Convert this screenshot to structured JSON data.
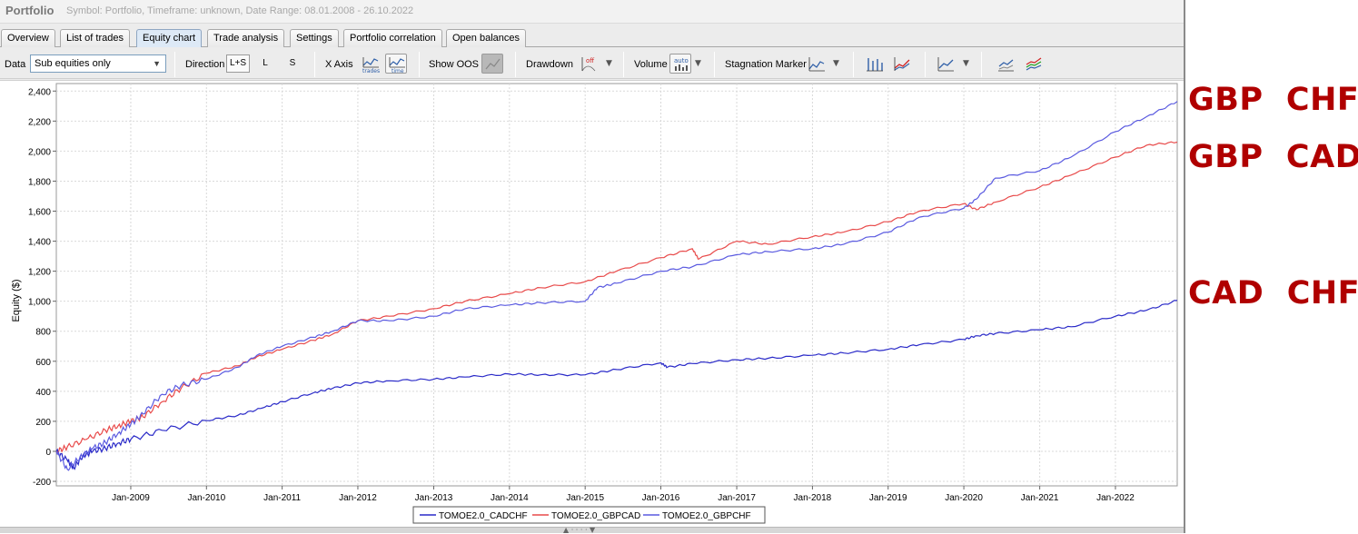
{
  "window": {
    "title": "Portfolio",
    "subtitle": "Symbol: Portfolio, Timeframe: unknown, Date Range: 08.01.2008 - 26.10.2022"
  },
  "tabs": [
    {
      "label": "Overview",
      "active": false
    },
    {
      "label": "List of trades",
      "active": false
    },
    {
      "label": "Equity chart",
      "active": true
    },
    {
      "label": "Trade analysis",
      "active": false
    },
    {
      "label": "Settings",
      "active": false
    },
    {
      "label": "Portfolio correlation",
      "active": false
    },
    {
      "label": "Open balances",
      "active": false
    }
  ],
  "toolbar": {
    "data_label": "Data",
    "data_value": "Sub equities only",
    "direction_label": "Direction",
    "direction_options": [
      "L+S",
      "L",
      "S"
    ],
    "direction_selected": "L+S",
    "xaxis_label": "X Axis",
    "xaxis_btn_trades": "trades",
    "xaxis_btn_time": "time",
    "show_oos_label": "Show OOS",
    "drawdown_label": "Drawdown",
    "drawdown_btn": "off",
    "volume_label": "Volume",
    "volume_btn": "auto",
    "stagnation_label": "Stagnation Marker"
  },
  "icons": {
    "dropdown": "chevron-down-icon",
    "trades_axis": "trades-axis-icon",
    "time_axis": "time-axis-icon",
    "show_oos": "oos-icon",
    "drawdown": "drawdown-icon",
    "volume": "volume-icon",
    "stagnation": "stagnation-icon",
    "chart_a": "bar-chart-icon",
    "chart_b": "line-chart-icon",
    "chart_c": "equity-line-icon",
    "chart_d": "compare-icon",
    "chart_e": "multi-series-icon"
  },
  "colors": {
    "cadchf": "#2a2ac8",
    "gbpcad": "#e84a4a",
    "gbpchf": "#5a5ae0",
    "annotation": "#b00000",
    "active_tab": "#dde9f6"
  },
  "annotations": [
    "GBP  CHF",
    "GBP  CAD",
    "CAD  CHF"
  ],
  "chart_data": {
    "type": "line",
    "title": "",
    "xlabel": "",
    "ylabel": "Equity ($)",
    "ylim": [
      -230,
      2450
    ],
    "xlim": [
      "2008-01-08",
      "2022-10-26"
    ],
    "y_ticks": [
      "-200",
      "0",
      "200",
      "400",
      "600",
      "800",
      "1,000",
      "1,200",
      "1,400",
      "1,600",
      "1,800",
      "2,000",
      "2,200",
      "2,400"
    ],
    "x_ticks": [
      "Jan-2009",
      "Jan-2010",
      "Jan-2011",
      "Jan-2012",
      "Jan-2013",
      "Jan-2014",
      "Jan-2015",
      "Jan-2016",
      "Jan-2017",
      "Jan-2018",
      "Jan-2019",
      "Jan-2020",
      "Jan-2021",
      "Jan-2022"
    ],
    "grid": true,
    "legend": "bottom-center",
    "series": [
      {
        "name": "TOMOE2.0_CADCHF",
        "color": "#2a2ac8",
        "points": [
          [
            "2008-01-08",
            0
          ],
          [
            "2008-03-01",
            -60
          ],
          [
            "2008-04-01",
            -110
          ],
          [
            "2008-05-15",
            -30
          ],
          [
            "2008-07-01",
            0
          ],
          [
            "2008-09-01",
            20
          ],
          [
            "2008-11-01",
            55
          ],
          [
            "2009-01-01",
            80
          ],
          [
            "2009-06-01",
            140
          ],
          [
            "2010-01-01",
            205
          ],
          [
            "2010-06-01",
            240
          ],
          [
            "2010-10-01",
            290
          ],
          [
            "2011-01-01",
            330
          ],
          [
            "2011-06-01",
            390
          ],
          [
            "2011-09-01",
            420
          ],
          [
            "2012-01-01",
            455
          ],
          [
            "2012-06-01",
            470
          ],
          [
            "2013-01-01",
            480
          ],
          [
            "2013-06-01",
            495
          ],
          [
            "2014-01-01",
            515
          ],
          [
            "2014-06-01",
            510
          ],
          [
            "2015-01-01",
            510
          ],
          [
            "2015-06-01",
            545
          ],
          [
            "2016-01-01",
            590
          ],
          [
            "2016-02-01",
            560
          ],
          [
            "2016-06-01",
            585
          ],
          [
            "2017-01-01",
            610
          ],
          [
            "2017-06-01",
            620
          ],
          [
            "2018-01-01",
            640
          ],
          [
            "2018-06-01",
            655
          ],
          [
            "2019-01-01",
            680
          ],
          [
            "2019-06-01",
            710
          ],
          [
            "2020-01-01",
            745
          ],
          [
            "2020-03-01",
            770
          ],
          [
            "2020-06-01",
            785
          ],
          [
            "2021-01-01",
            810
          ],
          [
            "2021-06-01",
            830
          ],
          [
            "2022-01-01",
            900
          ],
          [
            "2022-06-01",
            940
          ],
          [
            "2022-10-26",
            1005
          ]
        ]
      },
      {
        "name": "TOMOE2.0_GBPCAD",
        "color": "#e84a4a",
        "points": [
          [
            "2008-01-08",
            0
          ],
          [
            "2008-03-01",
            30
          ],
          [
            "2008-06-01",
            80
          ],
          [
            "2008-09-01",
            140
          ],
          [
            "2008-11-01",
            170
          ],
          [
            "2009-01-01",
            200
          ],
          [
            "2009-03-01",
            230
          ],
          [
            "2009-06-01",
            330
          ],
          [
            "2009-09-01",
            420
          ],
          [
            "2010-01-01",
            520
          ],
          [
            "2010-06-01",
            570
          ],
          [
            "2010-09-01",
            630
          ],
          [
            "2011-01-01",
            680
          ],
          [
            "2011-06-01",
            740
          ],
          [
            "2011-09-01",
            780
          ],
          [
            "2012-01-01",
            870
          ],
          [
            "2012-06-01",
            900
          ],
          [
            "2013-01-01",
            950
          ],
          [
            "2013-06-01",
            1000
          ],
          [
            "2014-01-01",
            1050
          ],
          [
            "2014-06-01",
            1090
          ],
          [
            "2015-01-01",
            1130
          ],
          [
            "2015-06-01",
            1200
          ],
          [
            "2016-01-01",
            1290
          ],
          [
            "2016-06-01",
            1350
          ],
          [
            "2016-07-01",
            1280
          ],
          [
            "2017-01-01",
            1400
          ],
          [
            "2017-06-01",
            1380
          ],
          [
            "2018-01-01",
            1430
          ],
          [
            "2018-06-01",
            1460
          ],
          [
            "2019-01-01",
            1530
          ],
          [
            "2019-06-01",
            1600
          ],
          [
            "2020-01-01",
            1650
          ],
          [
            "2020-03-01",
            1610
          ],
          [
            "2020-06-01",
            1660
          ],
          [
            "2021-01-01",
            1760
          ],
          [
            "2021-06-01",
            1840
          ],
          [
            "2022-01-01",
            1960
          ],
          [
            "2022-06-01",
            2040
          ],
          [
            "2022-10-26",
            2060
          ]
        ]
      },
      {
        "name": "TOMOE2.0_GBPCHF",
        "color": "#5a5ae0",
        "points": [
          [
            "2008-01-08",
            0
          ],
          [
            "2008-03-01",
            -120
          ],
          [
            "2008-05-01",
            -40
          ],
          [
            "2008-07-01",
            20
          ],
          [
            "2008-09-01",
            60
          ],
          [
            "2008-11-01",
            120
          ],
          [
            "2009-01-01",
            180
          ],
          [
            "2009-03-01",
            250
          ],
          [
            "2009-06-01",
            380
          ],
          [
            "2009-09-01",
            440
          ],
          [
            "2010-01-01",
            480
          ],
          [
            "2010-06-01",
            560
          ],
          [
            "2010-09-01",
            640
          ],
          [
            "2011-01-01",
            700
          ],
          [
            "2011-06-01",
            760
          ],
          [
            "2011-09-01",
            800
          ],
          [
            "2012-01-01",
            870
          ],
          [
            "2012-06-01",
            870
          ],
          [
            "2013-01-01",
            900
          ],
          [
            "2013-06-01",
            950
          ],
          [
            "2014-01-01",
            975
          ],
          [
            "2014-06-01",
            990
          ],
          [
            "2015-01-01",
            1000
          ],
          [
            "2015-03-01",
            1090
          ],
          [
            "2015-06-01",
            1120
          ],
          [
            "2016-01-01",
            1200
          ],
          [
            "2016-06-01",
            1230
          ],
          [
            "2017-01-01",
            1310
          ],
          [
            "2017-06-01",
            1330
          ],
          [
            "2018-01-01",
            1350
          ],
          [
            "2018-06-01",
            1380
          ],
          [
            "2019-01-01",
            1460
          ],
          [
            "2019-06-01",
            1560
          ],
          [
            "2020-01-01",
            1620
          ],
          [
            "2020-03-01",
            1680
          ],
          [
            "2020-06-01",
            1820
          ],
          [
            "2021-01-01",
            1870
          ],
          [
            "2021-06-01",
            1960
          ],
          [
            "2022-01-01",
            2130
          ],
          [
            "2022-06-01",
            2230
          ],
          [
            "2022-10-26",
            2330
          ]
        ]
      }
    ]
  }
}
